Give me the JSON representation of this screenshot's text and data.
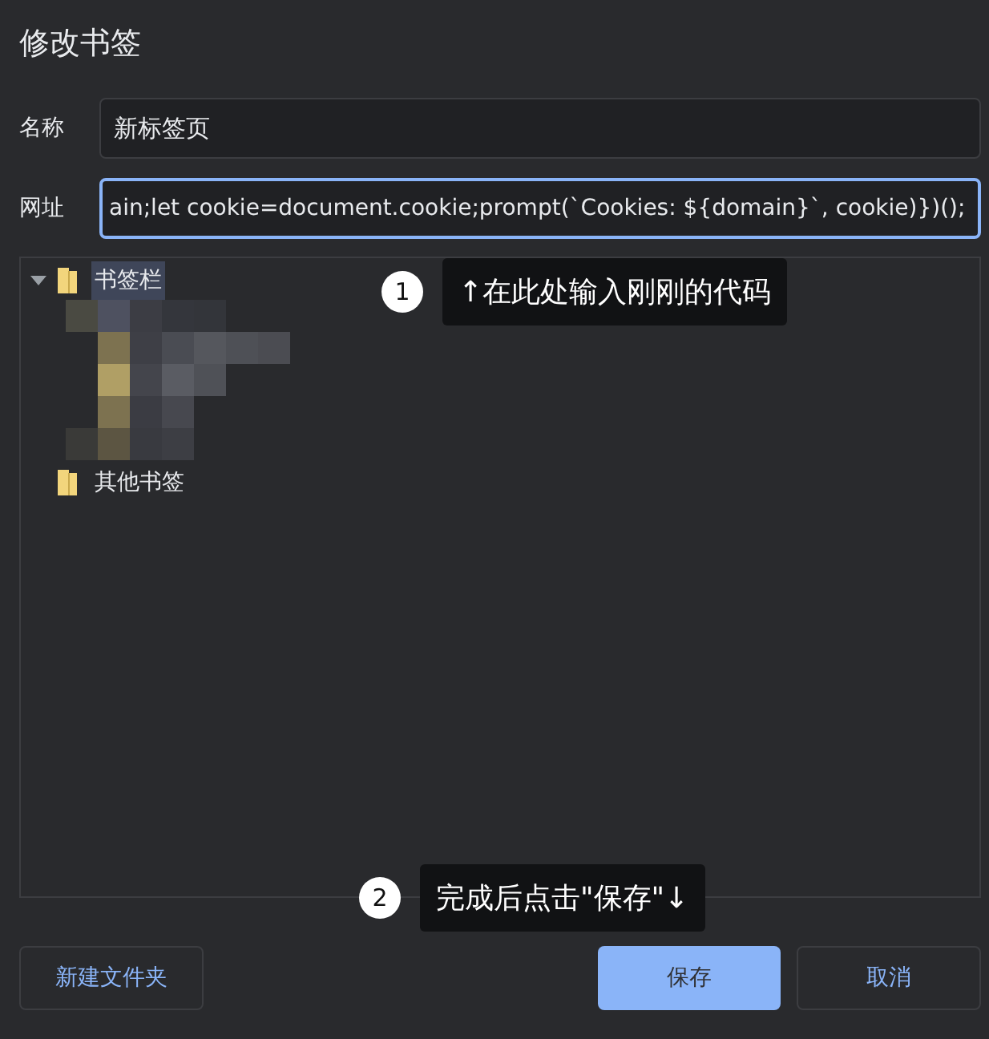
{
  "dialog": {
    "title": "修改书签"
  },
  "fields": [
    {
      "label": "名称",
      "value": "新标签页",
      "focused": false
    },
    {
      "label": "网址",
      "value": "ain;let cookie=document.cookie;prompt(`Cookies: ${domain}`, cookie)})();",
      "focused": true
    }
  ],
  "tree": [
    {
      "label": "书签栏",
      "selected": true,
      "expanded": true
    },
    {
      "label": "其他书签",
      "selected": false,
      "expanded": false
    }
  ],
  "annotations": [
    {
      "number": "1",
      "text": "↑在此处输入刚刚的代码"
    },
    {
      "number": "2",
      "text": "完成后点击\"保存\"↓"
    }
  ],
  "buttons": [
    {
      "label": "新建文件夹",
      "kind": "secondary"
    },
    {
      "label": "保存",
      "kind": "primary"
    },
    {
      "label": "取消",
      "kind": "secondary"
    }
  ]
}
